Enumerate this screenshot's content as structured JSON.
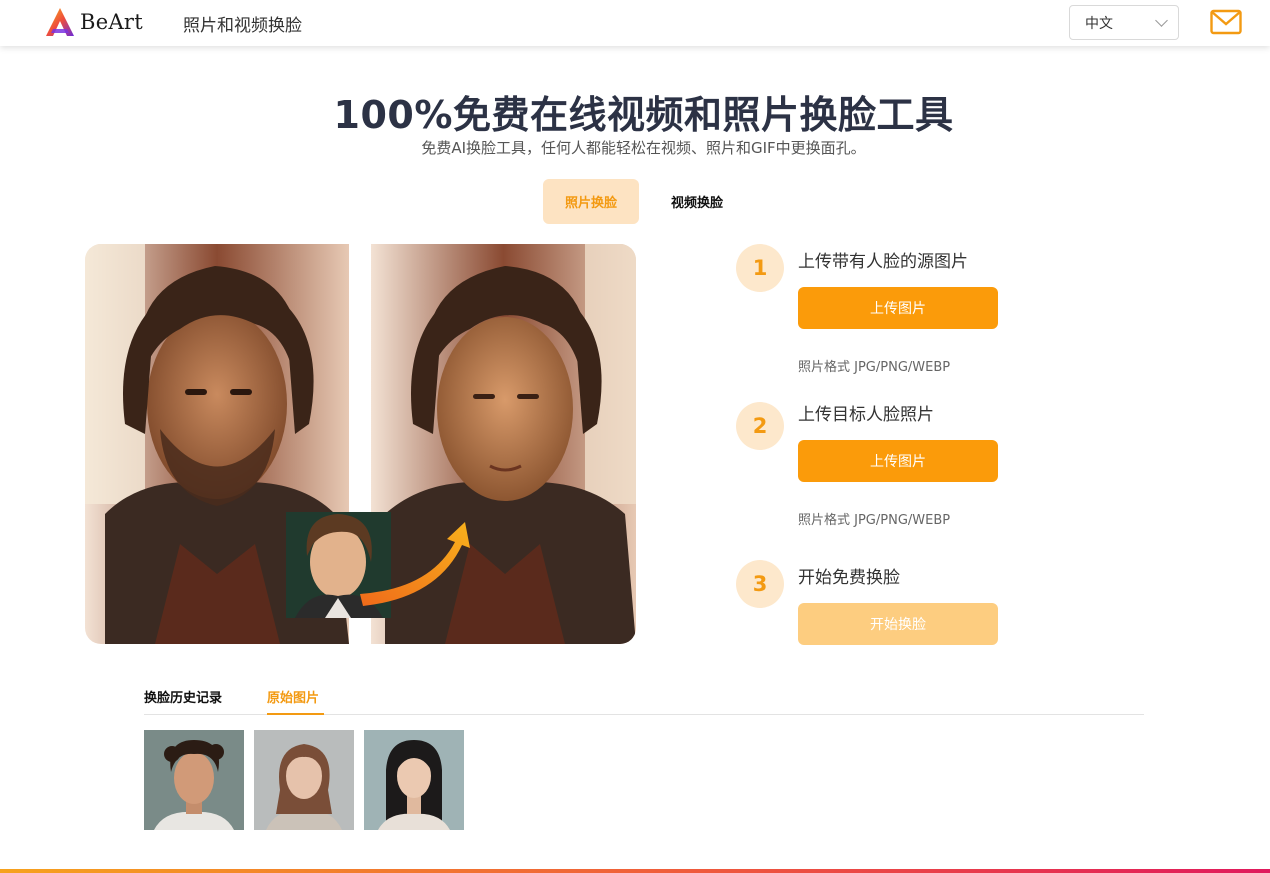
{
  "header": {
    "logo_text": "BeArt",
    "title": "照片和视频换脸",
    "language": "中文",
    "logo_icon": "beart-logo-icon",
    "mail_icon": "mail-icon"
  },
  "hero": {
    "title": "100%免费在线视频和照片换脸工具",
    "subtitle": "免费AI换脸工具，任何人都能轻松在视频、照片和GIF中更换面孔。"
  },
  "mode_tabs": [
    {
      "label": "照片换脸",
      "active": true
    },
    {
      "label": "视频换脸",
      "active": false
    }
  ],
  "steps": [
    {
      "number": "1",
      "label": "上传带有人脸的源图片",
      "button": "上传图片",
      "hint": "照片格式 JPG/PNG/WEBP"
    },
    {
      "number": "2",
      "label": "上传目标人脸照片",
      "button": "上传图片",
      "hint": "照片格式 JPG/PNG/WEBP"
    },
    {
      "number": "3",
      "label": "开始免费换脸",
      "button": "开始换脸"
    }
  ],
  "history": {
    "tabs": [
      {
        "label": "换脸历史记录",
        "active": false
      },
      {
        "label": "原始图片",
        "active": true
      }
    ]
  },
  "colors": {
    "accent": "#fb9b0a",
    "accent_light": "#fde3c2",
    "button_disabled": "#fdcd80",
    "title": "#2c3245"
  }
}
